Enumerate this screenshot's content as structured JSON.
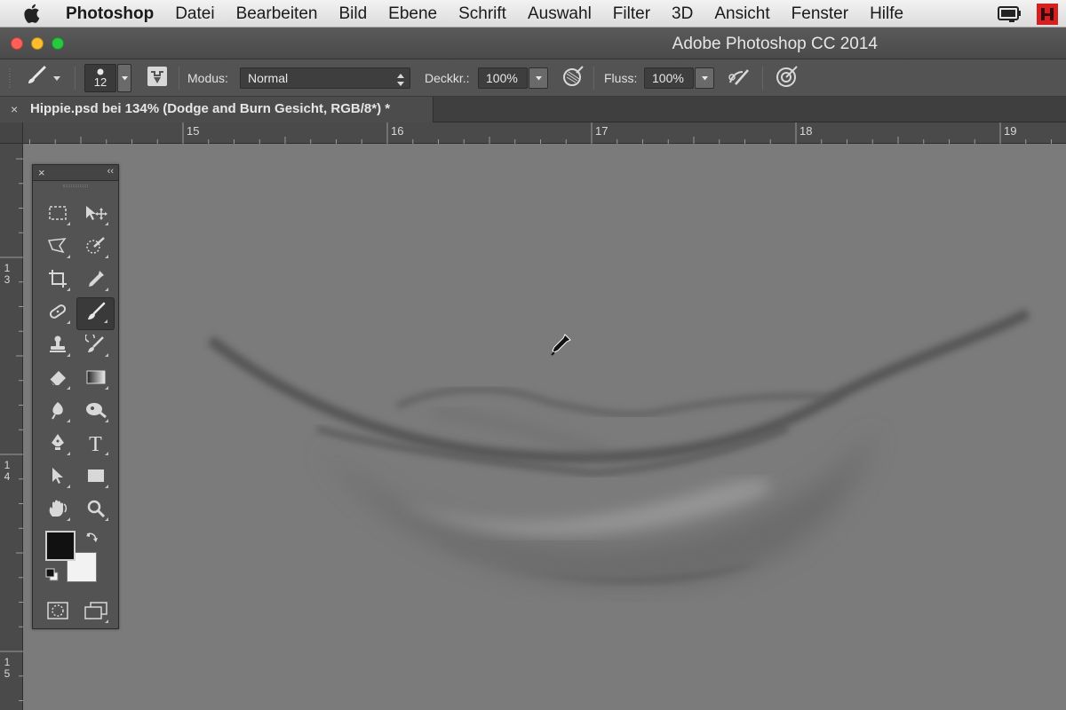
{
  "menubar": {
    "app_name": "Photoshop",
    "items": [
      "Datei",
      "Bearbeiten",
      "Bild",
      "Ebene",
      "Schrift",
      "Auswahl",
      "Filter",
      "3D",
      "Ansicht",
      "Fenster",
      "Hilfe"
    ]
  },
  "window": {
    "title": "Adobe Photoshop CC 2014"
  },
  "options": {
    "brush_size": "12",
    "mode_label": "Modus:",
    "mode_value": "Normal",
    "opacity_label": "Deckkr.:",
    "opacity_value": "100%",
    "flow_label": "Fluss:",
    "flow_value": "100%"
  },
  "document": {
    "tab_close": "×",
    "tab_title": "Hippie.psd bei 134% (Dodge and Burn Gesicht, RGB/8*) *"
  },
  "rulers": {
    "top_labels": [
      "15",
      "16",
      "17",
      "18",
      "19"
    ],
    "left_labels": [
      [
        "1",
        "3"
      ],
      [
        "1",
        "4"
      ],
      [
        "1",
        "5"
      ]
    ]
  },
  "tools_panel": {
    "close": "×",
    "collapse": "‹‹",
    "type_tool_glyph": "T"
  },
  "colors": {
    "foreground": "#111111",
    "background": "#f2f2f2",
    "canvas": "#7b7b7b"
  },
  "icons": [
    "apple-icon",
    "brush-icon",
    "brush-panel-icon",
    "airbrush-icon",
    "pressure-opacity-icon",
    "pressure-size-icon",
    "eyedropper-cursor-icon"
  ]
}
